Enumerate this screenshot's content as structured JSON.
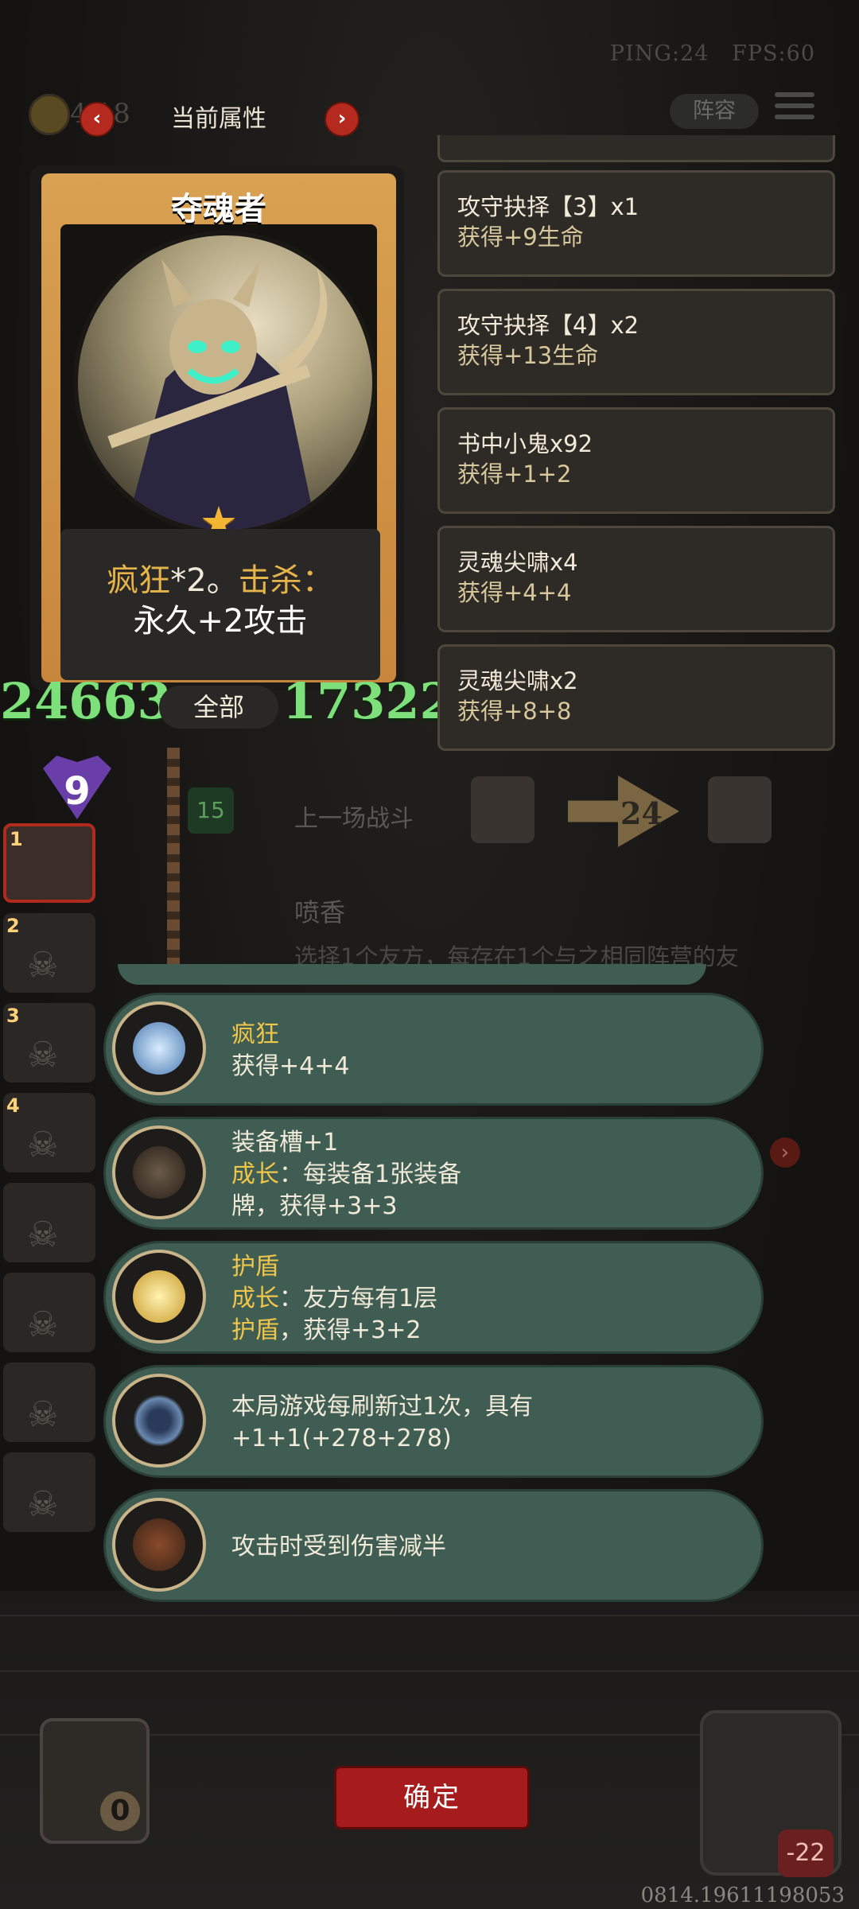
{
  "hud": {
    "ping": "PING:24",
    "fps": "FPS:60",
    "gold": "4 18",
    "title": "当前属性",
    "lineup": "阵容"
  },
  "hero": {
    "name": "夺魂者",
    "desc_part1": "疯狂",
    "desc_part2": "*2。",
    "desc_part3": "击杀：",
    "desc_line2": "永久+2攻击",
    "attack": "24663",
    "filter": "全部",
    "health": "17322"
  },
  "upgrades": [
    {
      "title": "攻守抉择【3】x1",
      "sub": "获得+9生命"
    },
    {
      "title": "攻守抉择【4】x2",
      "sub": "获得+13生命"
    },
    {
      "title": "书中小鬼x92",
      "sub": "获得+1+2"
    },
    {
      "title": "灵魂尖啸x4",
      "sub": "获得+4+4"
    },
    {
      "title": "灵魂尖啸x2",
      "sub": "获得+8+8"
    }
  ],
  "battle": {
    "level": "9",
    "shield_value": "15",
    "last_battle": "上一场战斗",
    "turn": "24",
    "skill_title": "喷香",
    "skill_desc": "选择1个友方，每存在1个与之相同阵营的友",
    "roster_numbers": [
      "1",
      "2",
      "3",
      "4"
    ]
  },
  "abilities": [
    {
      "icon": "lightning-crystal-icon",
      "line1": "疯狂",
      "line1_gold": true,
      "line2": "获得+4+4",
      "line3": ""
    },
    {
      "icon": "armor-slot-icon",
      "line1": "装备槽+1",
      "line1_gold": false,
      "line2_prefix": "成长",
      "line2": "：每装备1张装备",
      "line3": "牌，获得+3+3"
    },
    {
      "icon": "golden-shield-icon",
      "line1": "护盾",
      "line1_gold": true,
      "line2_prefix": "成长",
      "line2": "：友方每有1层",
      "line3_prefix": "护盾",
      "line3": "，获得+3+2"
    },
    {
      "icon": "refresh-ring-icon",
      "line1": "本局游戏每刷新过1次，具有",
      "line1_gold": false,
      "line2": "+1+1(+278+278)",
      "line3": ""
    },
    {
      "icon": "crossbow-icon",
      "line1": "攻击时受到伤害减半",
      "line1_gold": false,
      "line2": "",
      "line3": ""
    }
  ],
  "bottom": {
    "confirm": "确定",
    "coins": "0",
    "enemy_hp": "-22",
    "build_id": "0814.19611198053"
  },
  "colors": {
    "pill_bg": "#3f5d52",
    "stat_green": "#7ee07a",
    "gold_text": "#f0c64a",
    "confirm_red": "#a61c1c"
  }
}
